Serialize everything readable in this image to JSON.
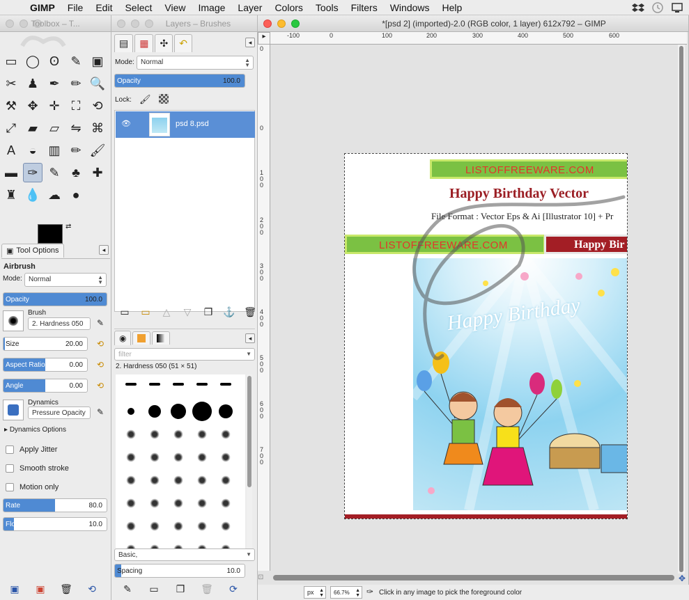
{
  "menubar": {
    "app": "GIMP",
    "items": [
      "File",
      "Edit",
      "Select",
      "View",
      "Image",
      "Layer",
      "Colors",
      "Tools",
      "Filters",
      "Windows",
      "Help"
    ]
  },
  "toolbox": {
    "title": "Toolbox – T...",
    "tools": [
      "rect-select-icon",
      "ellipse-select-icon",
      "free-select-icon",
      "fuzzy-select-icon",
      "color-select-icon",
      "scissors-icon",
      "foreground-select-icon",
      "paths-icon",
      "color-picker-icon",
      "zoom-icon",
      "measure-icon",
      "move-icon",
      "align-icon",
      "crop-icon",
      "rotate-icon",
      "scale-icon",
      "shear-icon",
      "perspective-icon",
      "flip-icon",
      "cage-icon",
      "text-icon",
      "bucket-fill-icon",
      "blend-icon",
      "pencil-icon",
      "paintbrush-icon",
      "eraser-icon",
      "airbrush-icon",
      "ink-icon",
      "clone-icon",
      "heal-icon",
      "perspective-clone-icon",
      "blur-icon",
      "smudge-icon",
      "dodge-icon"
    ],
    "tool_glyphs": [
      "▭",
      "◯",
      "ʘ",
      "✎",
      "▣",
      "✂",
      "♟",
      "✒",
      "✏",
      "🔍",
      "⚒",
      "✥",
      "✛",
      "⛶",
      "⟲",
      "⤢",
      "▰",
      "▱",
      "⇋",
      "⌘",
      "A",
      "◒",
      "▥",
      "✏",
      "🖌",
      "▬",
      "✑",
      "✎",
      "♣",
      "✚",
      "♜",
      "💧",
      "☁",
      "●"
    ],
    "colors": {
      "foreground": "#000000",
      "background": "#ffffff"
    }
  },
  "tool_options": {
    "tab_label": "Tool Options",
    "tool_name": "Airbrush",
    "mode_label": "Mode:",
    "mode_value": "Normal",
    "opacity": {
      "label": "Opacity",
      "value": "100.0",
      "fraction": 1.0
    },
    "brush_label": "Brush",
    "brush_value": "2. Hardness 050",
    "size": {
      "label": "Size",
      "value": "20.00",
      "fraction": 0.02
    },
    "aspect": {
      "label": "Aspect Ratio",
      "value": "0.00",
      "fraction": 0.5
    },
    "angle": {
      "label": "Angle",
      "value": "0.00",
      "fraction": 0.5
    },
    "dynamics_label": "Dynamics",
    "dynamics_value": "Pressure Opacity",
    "dynamics_options": "Dynamics Options",
    "apply_jitter": "Apply Jitter",
    "smooth_stroke": "Smooth stroke",
    "motion_only": "Motion only",
    "rate": {
      "label": "Rate",
      "value": "80.0",
      "fraction": 0.5
    },
    "flow": {
      "label": "Flow",
      "value": "10.0",
      "fraction": 0.1
    }
  },
  "layers": {
    "title": "Layers – Brushes",
    "mode_label": "Mode:",
    "mode_value": "Normal",
    "opacity": {
      "label": "Opacity",
      "value": "100.0",
      "fraction": 1.0
    },
    "lock_label": "Lock:",
    "layer_name": "psd 8.psd",
    "brush_filter": "filter",
    "brush_name": "2. Hardness 050 (51 × 51)",
    "brush_set": "Basic,",
    "spacing": {
      "label": "Spacing",
      "value": "10.0",
      "fraction": 0.05
    }
  },
  "image_window": {
    "title": "*[psd 2] (imported)-2.0 (RGB color, 1 layer) 612x792 – GIMP",
    "hruler": [
      "-100",
      "0",
      "100",
      "200",
      "300",
      "400",
      "500",
      "600"
    ],
    "vruler": [
      "0",
      "0",
      "100",
      "200",
      "300",
      "400",
      "500",
      "600",
      "700"
    ],
    "unit": "px",
    "zoom": "66.7%",
    "status": "Click in any image to pick the foreground color",
    "doc": {
      "banner_top": "LISTOFFREEWARE.COM",
      "title": "Happy Birthday Vector",
      "subtitle": "File Format : Vector Eps & Ai [Illustrator 10] + Pr",
      "banner_left": "LISTOFFREEWARE.COM",
      "banner_right": "Happy Bir",
      "art_text": "Happy Birthday"
    }
  }
}
